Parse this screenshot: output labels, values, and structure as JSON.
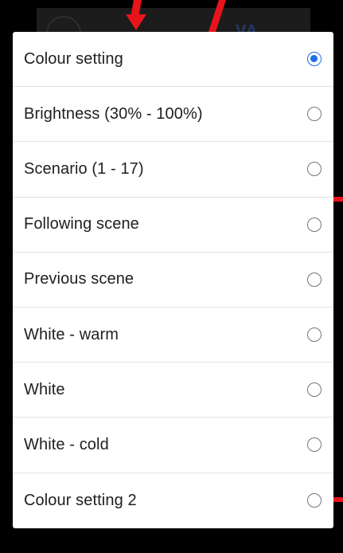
{
  "background": {
    "logo_text": "VA"
  },
  "dialog": {
    "options": [
      {
        "label": "Colour setting",
        "selected": true
      },
      {
        "label": "Brightness (30% - 100%)",
        "selected": false
      },
      {
        "label": "Scenario (1 - 17)",
        "selected": false
      },
      {
        "label": "Following scene",
        "selected": false
      },
      {
        "label": "Previous scene",
        "selected": false
      },
      {
        "label": "White - warm",
        "selected": false
      },
      {
        "label": "White",
        "selected": false
      },
      {
        "label": "White - cold",
        "selected": false
      },
      {
        "label": "Colour setting 2",
        "selected": false
      }
    ]
  },
  "colors": {
    "accent": "#1e6fe8",
    "annotation": "#e8141b"
  }
}
